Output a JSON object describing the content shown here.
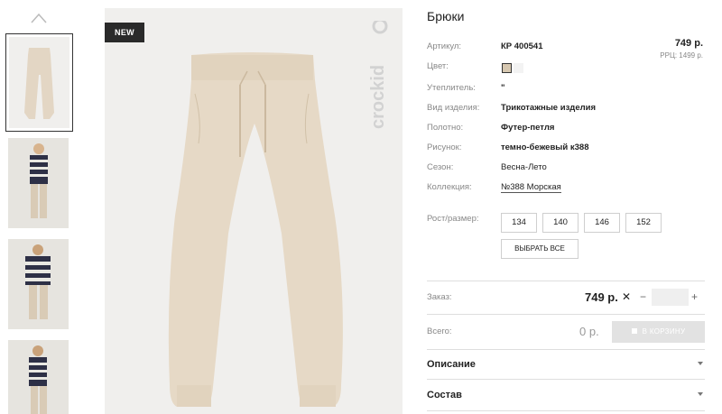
{
  "badge": "NEW",
  "brand_logo": "crockid",
  "product": {
    "title": "Брюки",
    "price": "749 р.",
    "rrp": "РРЦ: 1499 р."
  },
  "attributes": [
    {
      "label": "Артикул:",
      "value": "КР 400541"
    },
    {
      "label": "Цвет:",
      "value": ""
    },
    {
      "label": "Утеплитель:",
      "value": "\""
    },
    {
      "label": "Вид изделия:",
      "value": "Трикотажные изделия"
    },
    {
      "label": "Полотно:",
      "value": "Футер-петля"
    },
    {
      "label": "Рисунок:",
      "value": "темно-бежевый к388"
    },
    {
      "label": "Сезон:",
      "value": "Весна-Лето"
    },
    {
      "label": "Коллекция:",
      "value": "№388 Морская"
    }
  ],
  "colors": [
    "#d6c7b0",
    "#f3f3f3"
  ],
  "sizes": {
    "label": "Рост/размер:",
    "options": [
      "134",
      "140",
      "146",
      "152"
    ],
    "select_all": "ВЫБРАТЬ ВСЕ"
  },
  "order": {
    "label": "Заказ:",
    "price": "749 р.",
    "remove_symbol": "✕",
    "minus": "−",
    "plus": "+",
    "quantity": ""
  },
  "total": {
    "label": "Всего:",
    "value": "0 р.",
    "cart_button": "В КОРЗИНУ"
  },
  "accordions": [
    "Описание",
    "Состав"
  ]
}
